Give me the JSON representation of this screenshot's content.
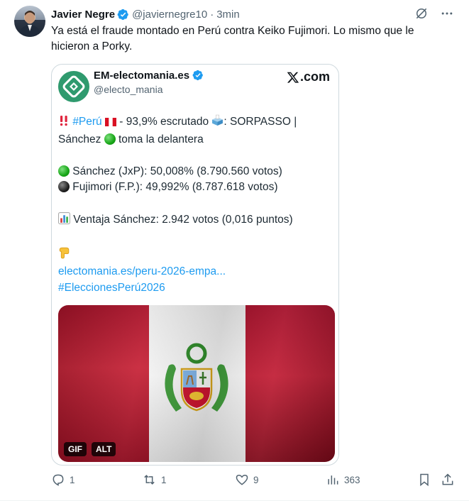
{
  "author": {
    "name": "Javier Negre",
    "handle": "@javiernegre10",
    "separator": "·",
    "time": "3min"
  },
  "tweet_text": "Ya está el fraude montado en Perú contra Keiko Fujimori. Lo mismo que le hicieron a Porky.",
  "quote": {
    "name": "EM-electomania.es",
    "handle": "@electo_mania",
    "site": ".com",
    "line1_hashtag": "#Perú",
    "line1_rest": " - 93,9% escrutado ",
    "line1_tail": ": SORPASSO |",
    "line2_a": "Sánchez ",
    "line2_b": " toma la delantera",
    "line3": " Sánchez (JxP): 50,008% (8.790.560 votos)",
    "line4": " Fujimori (F.P.): 49,992% (8.787.618 votos)",
    "line5": " Ventaja Sánchez: 2.942 votos (0,016 puntos)",
    "link": "electomania.es/peru-2026-empa...",
    "hashtag": "#EleccionesPerú2026",
    "media_badges": [
      "GIF",
      "ALT"
    ]
  },
  "actions": {
    "replies": "1",
    "reposts": "1",
    "likes": "9",
    "views": "363"
  },
  "icons": {
    "verified": "verified-badge-icon",
    "grok": "grok-icon",
    "more": "more-icon",
    "reply": "reply-icon",
    "repost": "repost-icon",
    "like": "heart-icon",
    "views": "views-icon",
    "bookmark": "bookmark-icon",
    "share": "share-icon"
  },
  "colors": {
    "link": "#1d9bf0",
    "verified": "#1d9bf0",
    "muted": "#536471",
    "brand": "#2f9a6e"
  }
}
